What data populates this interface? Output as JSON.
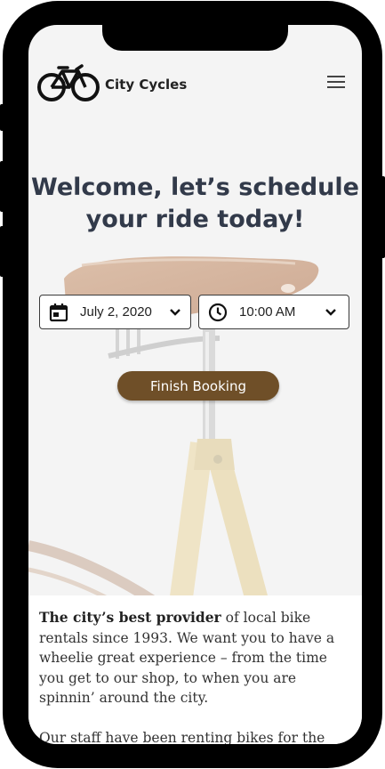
{
  "brand": {
    "name": "City Cycles",
    "logo_icon": "bicycle-icon"
  },
  "nav": {
    "menu_icon": "hamburger-menu-icon"
  },
  "hero": {
    "title": "Welcome, let’s schedule your ride today!"
  },
  "booking": {
    "date_value": "July 2, 2020",
    "date_icon": "calendar-icon",
    "time_value": "10:00 AM",
    "time_icon": "clock-icon",
    "dropdown_icon": "chevron-down-icon",
    "finish_label": "Finish Booking"
  },
  "about": {
    "highlight": "The city’s best provider",
    "paragraph1_rest": " of local bike rentals since 1993. We want you to have a wheelie great experience – from the time you get to our shop, to when you are spinnin’ around the city.",
    "paragraph2": "Our staff have been renting bikes for the"
  },
  "colors": {
    "accent": "#6f4f28",
    "title": "#323a4a",
    "background": "#f4f4f4"
  }
}
